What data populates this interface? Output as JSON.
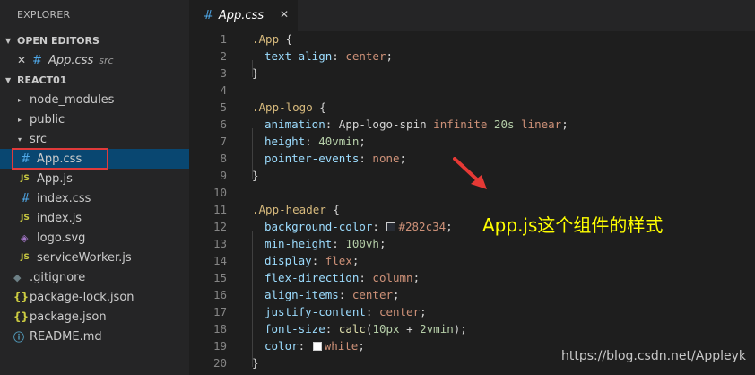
{
  "sidebar": {
    "title": "EXPLORER",
    "open_editors": {
      "header": "OPEN EDITORS",
      "items": [
        {
          "close_glyph": "✕",
          "icon_glyph": "#",
          "label": "App.css",
          "desc": "src"
        }
      ]
    },
    "project": {
      "header": "REACT01",
      "items": [
        {
          "arrow": "▸",
          "label": "node_modules",
          "icon": ""
        },
        {
          "arrow": "▸",
          "label": "public",
          "icon": ""
        },
        {
          "arrow": "▾",
          "label": "src",
          "icon": ""
        },
        {
          "label": "App.css",
          "icon_glyph": "#",
          "icon": "css-icon"
        },
        {
          "label": "App.js",
          "icon_glyph": "JS",
          "icon": "js-icon"
        },
        {
          "label": "index.css",
          "icon_glyph": "#",
          "icon": "css-icon"
        },
        {
          "label": "index.js",
          "icon_glyph": "JS",
          "icon": "js-icon"
        },
        {
          "label": "logo.svg",
          "icon_glyph": "◈",
          "icon": "svg-icon"
        },
        {
          "label": "serviceWorker.js",
          "icon_glyph": "JS",
          "icon": "js-icon"
        },
        {
          "label": ".gitignore",
          "icon_glyph": "◆",
          "icon": "git-icon"
        },
        {
          "label": "package-lock.json",
          "icon_glyph": "{}",
          "icon": "json-icon"
        },
        {
          "label": "package.json",
          "icon_glyph": "{}",
          "icon": "json-icon"
        },
        {
          "label": "README.md",
          "icon_glyph": "ⓘ",
          "icon": "info-icon"
        }
      ]
    }
  },
  "editor": {
    "tab": {
      "icon_glyph": "#",
      "label": "App.css",
      "close_glyph": "✕"
    },
    "line_numbers": [
      "1",
      "2",
      "3",
      "4",
      "5",
      "6",
      "7",
      "8",
      "9",
      "10",
      "11",
      "12",
      "13",
      "14",
      "15",
      "16",
      "17",
      "18",
      "19",
      "20"
    ],
    "code": {
      "l1_selector": ".App",
      "l1_brace": " {",
      "l2_prop": "text-align",
      "l2_value": "center",
      "l3": "}",
      "l5_selector": ".App-logo",
      "l5_brace": " {",
      "l6_prop": "animation",
      "l6_fn": "App-logo-spin",
      "l6_kw1": "infinite",
      "l6_num": "20s",
      "l6_kw2": "linear",
      "l7_prop": "height",
      "l7_value": "40vmin",
      "l8_prop": "pointer-events",
      "l8_value": "none",
      "l9": "}",
      "l11_selector": ".App-header",
      "l11_brace": " {",
      "l12_prop": "background-color",
      "l12_value": "#282c34",
      "l13_prop": "min-height",
      "l13_value": "100vh",
      "l14_prop": "display",
      "l14_value": "flex",
      "l15_prop": "flex-direction",
      "l15_value": "column",
      "l16_prop": "align-items",
      "l16_value": "center",
      "l17_prop": "justify-content",
      "l17_value": "center",
      "l18_prop": "font-size",
      "l18_fn": "calc",
      "l18_open": "(",
      "l18_a": "10px",
      "l18_op": " + ",
      "l18_b": "2vmin",
      "l18_close": ")",
      "l19_prop": "color",
      "l19_value": "white",
      "l20": "}"
    },
    "swatch_colors": {
      "l12": "#282c34",
      "l19": "#ffffff"
    }
  },
  "annotation": {
    "text": "App.js这个组件的样式",
    "color": "#ffff00",
    "arrow_color": "#e53935"
  },
  "watermark": "https://blog.csdn.net/Appleyk",
  "colors": {
    "selection": "#094771",
    "highlight_box": "#e03a3a"
  }
}
